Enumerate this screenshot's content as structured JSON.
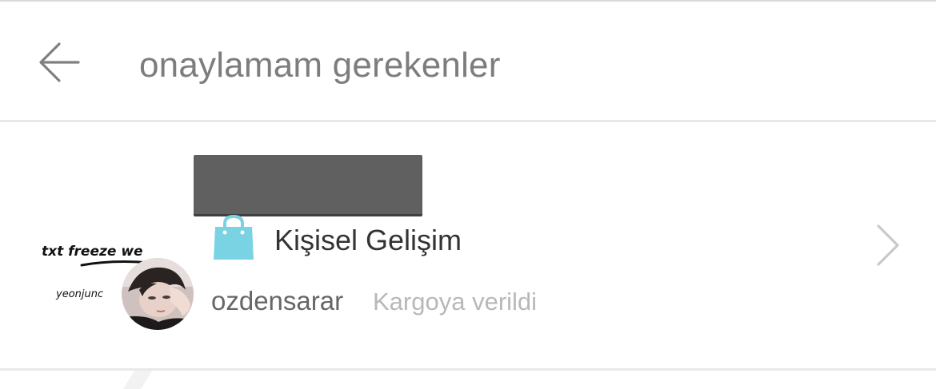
{
  "header": {
    "title": "onaylamam gerekenler",
    "back_icon": "arrow-left-icon"
  },
  "item": {
    "title": "Kişisel Gelişim",
    "username": "ozdensarar",
    "status": "Kargoya verildi",
    "bag_icon": "shopping-bag-icon",
    "bag_color": "#7ad3e3",
    "chevron_icon": "chevron-right-icon",
    "thumbnail_text": {
      "line1": "txt freeze we",
      "line2": "yeonjunc"
    }
  }
}
